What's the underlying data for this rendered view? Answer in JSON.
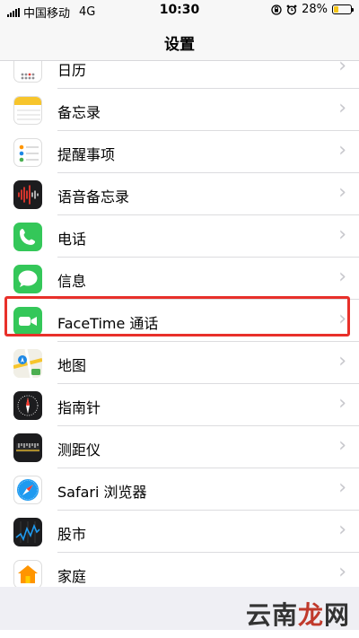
{
  "status_bar": {
    "carrier": "中国移动",
    "network": "4G",
    "time": "10:30",
    "battery_percent": "28%",
    "battery_level": 0.28,
    "icons": [
      "signal-icon",
      "rotation-lock-icon",
      "alarm-icon",
      "battery-icon"
    ]
  },
  "nav": {
    "title": "设置"
  },
  "rows": [
    {
      "label": "日历",
      "icon": "calendar-icon"
    },
    {
      "label": "备忘录",
      "icon": "notes-icon"
    },
    {
      "label": "提醒事项",
      "icon": "reminders-icon"
    },
    {
      "label": "语音备忘录",
      "icon": "voice-memos-icon"
    },
    {
      "label": "电话",
      "icon": "phone-icon"
    },
    {
      "label": "信息",
      "icon": "messages-icon"
    },
    {
      "label": "FaceTime 通话",
      "icon": "facetime-icon",
      "highlighted": true
    },
    {
      "label": "地图",
      "icon": "maps-icon"
    },
    {
      "label": "指南针",
      "icon": "compass-icon"
    },
    {
      "label": "测距仪",
      "icon": "measure-icon"
    },
    {
      "label": "Safari 浏览器",
      "icon": "safari-icon"
    },
    {
      "label": "股市",
      "icon": "stocks-icon"
    },
    {
      "label": "家庭",
      "icon": "home-icon"
    }
  ],
  "colors": {
    "highlight": "#e8302a",
    "chevron": "#c7c7cc",
    "background": "#efeff4"
  },
  "watermark": {
    "text_dark": "云南",
    "text_red": "龙",
    "text_dark2": "网"
  }
}
